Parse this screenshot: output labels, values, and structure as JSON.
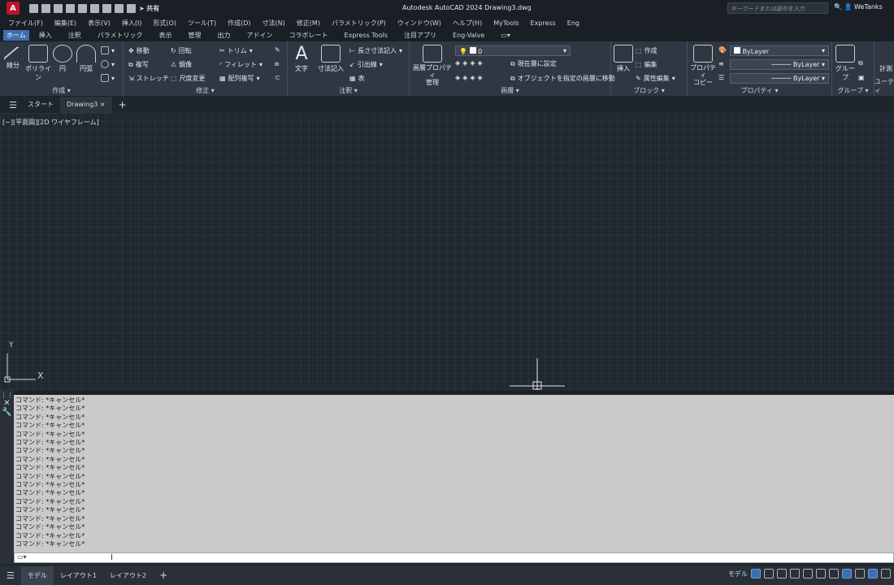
{
  "window": {
    "title": "Autodesk AutoCAD 2024    Drawing3.dwg",
    "search_placeholder": "キーワードまたは語句を入力",
    "user": "WeTanks",
    "share_label": "共有",
    "logo_letter": "A"
  },
  "menu": [
    "ファイル(F)",
    "編集(E)",
    "表示(V)",
    "挿入(I)",
    "形式(O)",
    "ツール(T)",
    "作成(D)",
    "寸法(N)",
    "修正(M)",
    "パラメトリック(P)",
    "ウィンドウ(W)",
    "ヘルプ(H)",
    "MyTools",
    "Express",
    "Eng"
  ],
  "ribbon_tabs": [
    "ホーム",
    "挿入",
    "注釈",
    "パラメトリック",
    "表示",
    "管理",
    "出力",
    "アドイン",
    "コラボレート",
    "Express Tools",
    "注目アプリ",
    "Eng-Valve"
  ],
  "ribbon": {
    "draw": {
      "title": "作成 ▾",
      "line": "線分",
      "polyline": "ポリライン",
      "circle": "円",
      "arc": "円弧"
    },
    "modify": {
      "title": "修正 ▾",
      "move": "移動",
      "rotate": "回転",
      "trim": "トリム",
      "copy": "複写",
      "mirror": "鏡像",
      "fillet": "フィレット",
      "stretch": "ストレッチ",
      "scale": "尺度変更",
      "array": "配列複写"
    },
    "annotation": {
      "title": "注釈 ▾",
      "text": "文字",
      "dimension": "寸法記入",
      "linear": "長さ寸法記入",
      "leader": "引出線",
      "table": "表"
    },
    "layers": {
      "title": "画層 ▾",
      "props": "画層プロパティ\n管理",
      "current_layer": "0",
      "set_current": "現在層に設定",
      "match_layer": "オブジェクトを指定の画層に移動"
    },
    "block": {
      "title": "ブロック ▾",
      "insert": "挿入",
      "create": "作成",
      "edit": "編集",
      "attr": "属性編集"
    },
    "properties": {
      "title": "プロパティ ▾",
      "match": "プロパティ\nコピー",
      "color": "ByLayer",
      "linetype": "ByLayer",
      "lineweight": "ByLayer"
    },
    "groups": {
      "title": "グループ ▾",
      "group": "グループ"
    },
    "utilities": {
      "title": "ユーティ",
      "measure": "計測"
    }
  },
  "doc_tabs": {
    "start": "スタート",
    "current": "Drawing3",
    "close": "×",
    "add": "+"
  },
  "viewport_label": "[−][平面図][2D ワイヤフレーム]",
  "ucs": {
    "x": "X",
    "y": "Y"
  },
  "command_history": [
    "コマンド: *キャンセル*",
    "コマンド: *キャンセル*",
    "コマンド: *キャンセル*",
    "コマンド: *キャンセル*",
    "コマンド: *キャンセル*",
    "コマンド: *キャンセル*",
    "コマンド: *キャンセル*",
    "コマンド: *キャンセル*",
    "コマンド: *キャンセル*",
    "コマンド: *キャンセル*",
    "コマンド: *キャンセル*",
    "コマンド: *キャンセル*",
    "コマンド: *キャンセル*",
    "コマンド: *キャンセル*",
    "コマンド: *キャンセル*",
    "コマンド: *キャンセル*",
    "コマンド: *キャンセル*",
    "コマンド: *キャンセル*"
  ],
  "status_tabs": [
    "モデル",
    "レイアウト1",
    "レイアウト2"
  ],
  "status_add": "+",
  "status_model": "モデル"
}
